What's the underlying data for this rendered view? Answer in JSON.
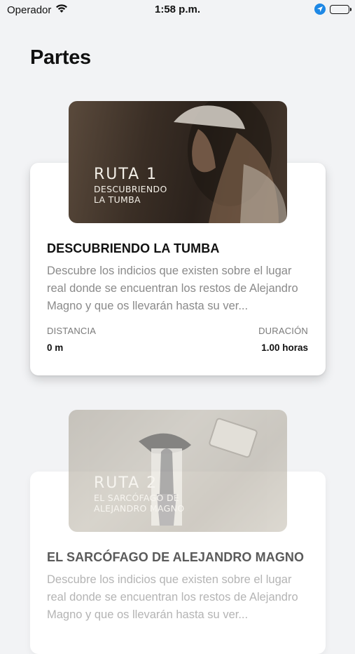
{
  "status_bar": {
    "carrier": "Operador",
    "time": "1:58 p.m."
  },
  "page": {
    "title": "Partes"
  },
  "routes": [
    {
      "image_number": "RUTA 1",
      "image_line1": "DESCUBRIENDO",
      "image_line2": "LA TUMBA",
      "title": "DESCUBRIENDO LA TUMBA",
      "description": "Descubre los indicios que existen sobre el lugar real donde se encuentran los restos de Alejandro Magno y que os llevarán hasta su ver...",
      "distance_label": "DISTANCIA",
      "distance_value": "0 m",
      "duration_label": "DURACIÓN",
      "duration_value": "1.00 horas"
    },
    {
      "image_number": "RUTA 2",
      "image_line1": "EL SARCÓFAGO DE",
      "image_line2": "ALEJANDRO MAGNO",
      "title": "EL SARCÓFAGO DE ALEJANDRO MAGNO",
      "description": "Descubre los indicios que existen sobre el lugar real donde se encuentran los restos de Alejandro Magno y que os llevarán hasta su ver..."
    }
  ],
  "colors": {
    "background": "#f2f3f5",
    "location_icon": "#1e88e5"
  }
}
